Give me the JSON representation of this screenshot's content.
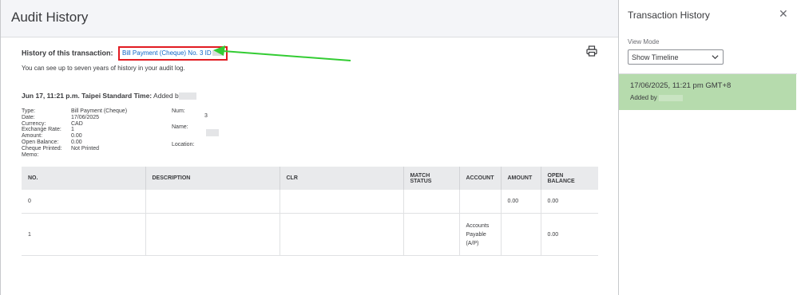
{
  "header": {
    "title": "Audit History"
  },
  "history": {
    "label": "History of this transaction:",
    "link_text": "Bill Payment (Cheque) No. 3 ID",
    "note": "You can see up to seven years of history in your audit log."
  },
  "entry": {
    "time_label": "Jun 17, 11:21 p.m. Taipei Standard Time:",
    "added_text": "Added b",
    "fields": [
      {
        "label": "Type:",
        "value": "Bill Payment (Cheque)"
      },
      {
        "label": "Date:",
        "value": "17/06/2025"
      },
      {
        "label": "Currency:",
        "value": "CAD"
      },
      {
        "label": "Exchange Rate:",
        "value": "1"
      },
      {
        "label": "Amount:",
        "value": "0.00"
      },
      {
        "label": "Open Balance:",
        "value": "0.00"
      },
      {
        "label": "Cheque Printed:",
        "value": "Not Printed"
      },
      {
        "label": "Memo:",
        "value": ""
      }
    ],
    "num_label": "Num:",
    "num_value": "3",
    "name_label": "Name:",
    "location_label": "Location:"
  },
  "table": {
    "headers": [
      "NO.",
      "DESCRIPTION",
      "CLR",
      "MATCH STATUS",
      "ACCOUNT",
      "AMOUNT",
      "OPEN BALANCE"
    ],
    "rows": [
      [
        "0",
        "",
        "",
        "",
        "",
        "0.00",
        "0.00"
      ],
      [
        "1",
        "",
        "",
        "",
        "Accounts Payable (A/P)",
        "",
        "0.00"
      ]
    ]
  },
  "panel": {
    "title": "Transaction History",
    "view_mode_label": "View Mode",
    "view_mode_value": "Show Timeline",
    "timeline": [
      {
        "time": "17/06/2025, 11:21 pm GMT+8",
        "added": "Added by"
      }
    ]
  },
  "colors": {
    "link": "#0d65c6",
    "highlight_box": "#e11b22",
    "arrow": "#33cc33",
    "timeline_selected": "#b6dbad",
    "table_header": "#e9eaec"
  },
  "icons": {
    "print": "printer-icon",
    "close": "close-icon",
    "chevron": "chevron-down-icon",
    "arrow": "green-arrow"
  }
}
